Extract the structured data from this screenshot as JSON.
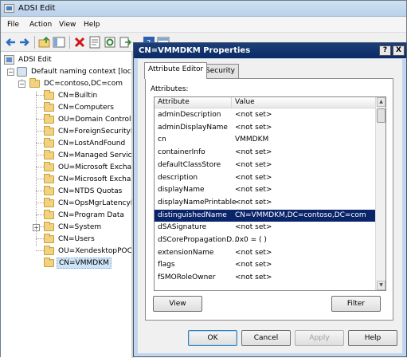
{
  "window": {
    "title": "ADSI Edit"
  },
  "menu": [
    "File",
    "Action",
    "View",
    "Help"
  ],
  "tree": {
    "root": "ADSI Edit",
    "context": "Default naming context [localho",
    "domain": "DC=contoso,DC=com",
    "children": [
      "CN=Builtin",
      "CN=Computers",
      "OU=Domain Controllers",
      "CN=ForeignSecurityPrin",
      "CN=LostAndFound",
      "CN=Managed Service A",
      "OU=Microsoft Exchang",
      "CN=Microsoft Exchange",
      "CN=NTDS Quotas",
      "CN=OpsMgrLatencyMo",
      "CN=Program Data",
      "CN=System",
      "CN=Users",
      "OU=XendesktopPOC",
      "CN=VMMDKM"
    ],
    "expander_minus": "−",
    "expander_plus": "+"
  },
  "dialog": {
    "title": "CN=VMMDKM Properties",
    "help_btn": "?",
    "close_btn": "X",
    "tabs": [
      "Attribute Editor",
      "Security"
    ],
    "attributes_label": "Attributes:",
    "columns": [
      "Attribute",
      "Value"
    ],
    "rows": [
      {
        "attribute": "adminDescription",
        "value": "<not set>"
      },
      {
        "attribute": "adminDisplayName",
        "value": "<not set>"
      },
      {
        "attribute": "cn",
        "value": "VMMDKM"
      },
      {
        "attribute": "containerInfo",
        "value": "<not set>"
      },
      {
        "attribute": "defaultClassStore",
        "value": "<not set>"
      },
      {
        "attribute": "description",
        "value": "<not set>"
      },
      {
        "attribute": "displayName",
        "value": "<not set>"
      },
      {
        "attribute": "displayNamePrintable",
        "value": "<not set>"
      },
      {
        "attribute": "distinguishedName",
        "value": "CN=VMMDKM,DC=contoso,DC=com"
      },
      {
        "attribute": "dSASignature",
        "value": "<not set>"
      },
      {
        "attribute": "dSCorePropagationD...",
        "value": "0x0 = ( )"
      },
      {
        "attribute": "extensionName",
        "value": "<not set>"
      },
      {
        "attribute": "flags",
        "value": "<not set>"
      },
      {
        "attribute": "fSMORoleOwner",
        "value": "<not set>"
      }
    ],
    "view_btn": "View",
    "filter_btn": "Filter",
    "ok_btn": "OK",
    "cancel_btn": "Cancel",
    "apply_btn": "Apply",
    "help_button": "Help",
    "scroll_up": "▲",
    "scroll_down": "▼"
  },
  "colors": {
    "selection": "#0a246a",
    "dialog_title": "#0a2a66",
    "folder": "#f1d27e"
  }
}
